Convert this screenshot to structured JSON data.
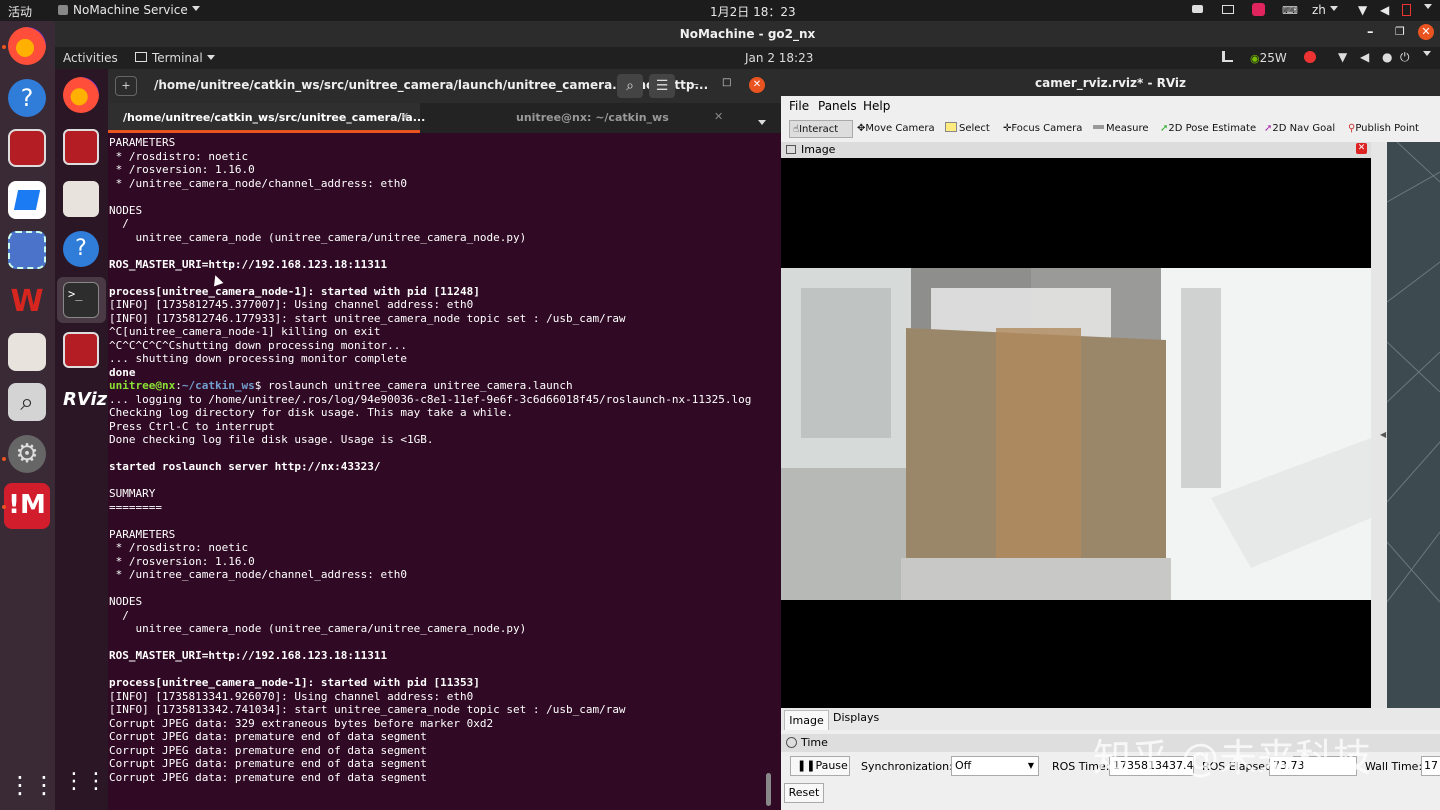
{
  "host_bar": {
    "activities": "活动",
    "app_menu": "NoMachine Service",
    "clock": "1月2日  18：23",
    "lang": "zh"
  },
  "nomachine": {
    "title": "NoMachine - go2_nx"
  },
  "guest_panel": {
    "activities": "Activities",
    "app": "Terminal",
    "clock": "Jan 2  18:23",
    "power": "25W"
  },
  "terminal": {
    "title": "/home/unitree/catkin_ws/src/unitree_camera/launch/unitree_camera.launch http...",
    "tabs": [
      {
        "label": "/home/unitree/catkin_ws/src/unitree_camera/la..."
      },
      {
        "label": "unitree@nx: ~/catkin_ws"
      }
    ],
    "lines": [
      "PARAMETERS",
      " * /rosdistro: noetic",
      " * /rosversion: 1.16.0",
      " * /unitree_camera_node/channel_address: eth0",
      "",
      "NODES",
      "  /",
      "    unitree_camera_node (unitree_camera/unitree_camera_node.py)",
      "",
      "ROS_MASTER_URI=http://192.168.123.18:11311",
      "",
      "process[unitree_camera_node-1]: started with pid [11248]",
      "[INFO] [1735812745.377007]: Using channel address: eth0",
      "[INFO] [1735812746.177933]: start unitree_camera_node topic set : /usb_cam/raw",
      "^C[unitree_camera_node-1] killing on exit",
      "^C^C^C^C^Cshutting down processing monitor...",
      "... shutting down processing monitor complete",
      "done",
      "",
      "... logging to /home/unitree/.ros/log/94e90036-c8e1-11ef-9e6f-3c6d66018f45/roslaunch-nx-11325.log",
      "Checking log directory for disk usage. This may take a while.",
      "Press Ctrl-C to interrupt",
      "Done checking log file disk usage. Usage is <1GB.",
      "",
      "started roslaunch server http://nx:43323/",
      "",
      "SUMMARY",
      "========",
      "",
      "PARAMETERS",
      " * /rosdistro: noetic",
      " * /rosversion: 1.16.0",
      " * /unitree_camera_node/channel_address: eth0",
      "",
      "NODES",
      "  /",
      "    unitree_camera_node (unitree_camera/unitree_camera_node.py)",
      "",
      "ROS_MASTER_URI=http://192.168.123.18:11311",
      "",
      "process[unitree_camera_node-1]: started with pid [11353]",
      "[INFO] [1735813341.926070]: Using channel address: eth0",
      "[INFO] [1735813342.741034]: start unitree_camera_node topic set : /usb_cam/raw",
      "Corrupt JPEG data: 329 extraneous bytes before marker 0xd2",
      "Corrupt JPEG data: premature end of data segment",
      "Corrupt JPEG data: premature end of data segment",
      "Corrupt JPEG data: premature end of data segment",
      "Corrupt JPEG data: premature end of data segment"
    ],
    "prompt": {
      "user": "unitree@nx",
      "sep": ":",
      "path": "~/catkin_ws",
      "dollar": "$",
      "command": " roslaunch unitree_camera unitree_camera.launch"
    }
  },
  "rviz": {
    "title": "camer_rviz.rviz* - RViz",
    "menu": [
      "File",
      "Panels",
      "Help"
    ],
    "tools": [
      "Interact",
      "Move Camera",
      "Select",
      "Focus Camera",
      "Measure",
      "2D Pose Estimate",
      "2D Nav Goal",
      "Publish Point"
    ],
    "image_panel_title": "Image",
    "tabs": [
      "Image",
      "Displays"
    ],
    "time_panel": {
      "title": "Time",
      "pause": "Pause",
      "sync_label": "Synchronization:",
      "sync_value": "Off",
      "ros_time_label": "ROS Time:",
      "ros_time_value": "1735813437.40",
      "ros_elapsed_label": "ROS Elapsed:",
      "ros_elapsed_value": "73.73",
      "wall_time_label": "Wall Time:",
      "wall_time_value": "17",
      "reset": "Reset"
    }
  },
  "watermark": "知乎 @未来科技",
  "colors": {
    "terminal_bg": "#300a24",
    "prompt_green": "#8ae234",
    "prompt_blue": "#729fcf",
    "ubuntu_orange": "#e95420"
  }
}
